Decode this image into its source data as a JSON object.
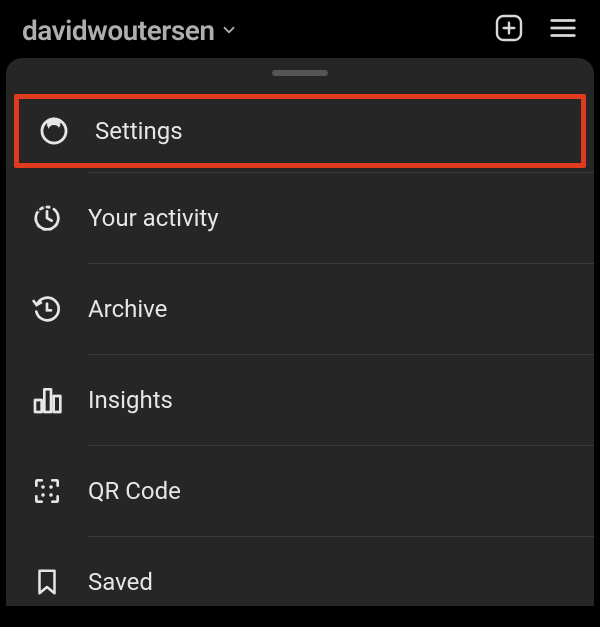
{
  "header": {
    "username": "davidwoutersen"
  },
  "menu": {
    "items": [
      {
        "label": "Settings",
        "icon": "settings"
      },
      {
        "label": "Your activity",
        "icon": "activity"
      },
      {
        "label": "Archive",
        "icon": "archive"
      },
      {
        "label": "Insights",
        "icon": "insights"
      },
      {
        "label": "QR Code",
        "icon": "qrcode"
      },
      {
        "label": "Saved",
        "icon": "saved"
      }
    ]
  },
  "colors": {
    "highlight": "#e03a1f",
    "sheet_bg": "#262626"
  }
}
